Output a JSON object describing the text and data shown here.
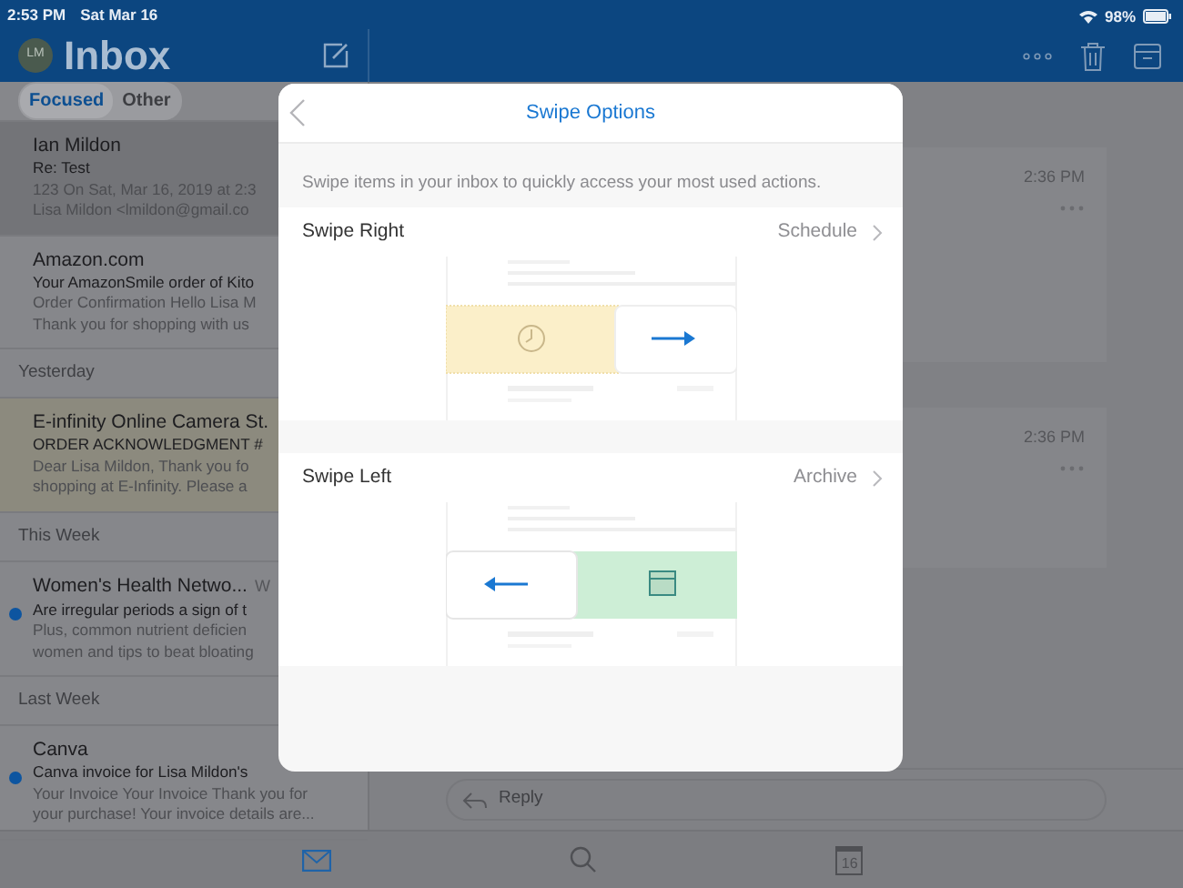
{
  "status_bar": {
    "time": "2:53 PM",
    "date": "Sat Mar 16",
    "battery": "98%"
  },
  "header": {
    "avatar_initials": "LM",
    "title": "Inbox"
  },
  "filter_tabs": [
    {
      "label": "Focused",
      "selected": true
    },
    {
      "label": "Other",
      "selected": false
    }
  ],
  "mail_list": [
    {
      "kind": "message",
      "sender": "Ian Mildon",
      "subject": "Re: Test",
      "preview": [
        "123 On Sat, Mar 16, 2019 at 2:3",
        "Lisa Mildon <lmildon@gmail.co"
      ],
      "unread": false,
      "selected": true,
      "flagged": false
    },
    {
      "kind": "message",
      "sender": "Amazon.com",
      "subject": "Your AmazonSmile order of Kito",
      "preview": [
        "Order Confirmation Hello Lisa M",
        "Thank you for shopping with us"
      ],
      "unread": false,
      "selected": false,
      "flagged": false
    },
    {
      "kind": "section",
      "label": "Yesterday"
    },
    {
      "kind": "message",
      "sender": "E-infinity Online Camera St.",
      "subject": "ORDER ACKNOWLEDGMENT #",
      "preview": [
        "Dear Lisa Mildon, Thank you fo",
        "shopping at E-Infinity. Please a"
      ],
      "unread": false,
      "selected": false,
      "flagged": true
    },
    {
      "kind": "section",
      "label": "This Week"
    },
    {
      "kind": "message",
      "sender": "Women's Health Netwo...",
      "time": "W",
      "subject": "Are irregular periods a sign of t",
      "preview": [
        "Plus, common nutrient deficien",
        "women and tips to beat bloating"
      ],
      "unread": true,
      "selected": false,
      "flagged": false
    },
    {
      "kind": "section",
      "label": "Last Week"
    },
    {
      "kind": "message",
      "sender": "Canva",
      "subject": "Canva invoice for Lisa Mildon's",
      "preview": [
        "Your Invoice Your Invoice Thank you for",
        "your purchase! Your invoice details are..."
      ],
      "unread": true,
      "selected": false,
      "flagged": false
    }
  ],
  "message_cards": [
    {
      "time": "2:36 PM"
    },
    {
      "time": "2:36 PM"
    }
  ],
  "reply": {
    "placeholder": "Reply"
  },
  "modal": {
    "title": "Swipe Options",
    "description": "Swipe items in your inbox to quickly access your most used actions.",
    "options": [
      {
        "label": "Swipe Right",
        "value": "Schedule",
        "kind": "swipe_right"
      },
      {
        "label": "Swipe Left",
        "value": "Archive",
        "kind": "swipe_left"
      }
    ]
  },
  "tab_bar": [
    {
      "kind": "mail",
      "selected": true
    },
    {
      "kind": "search",
      "selected": false
    },
    {
      "kind": "calendar",
      "day": "16",
      "selected": false
    }
  ]
}
